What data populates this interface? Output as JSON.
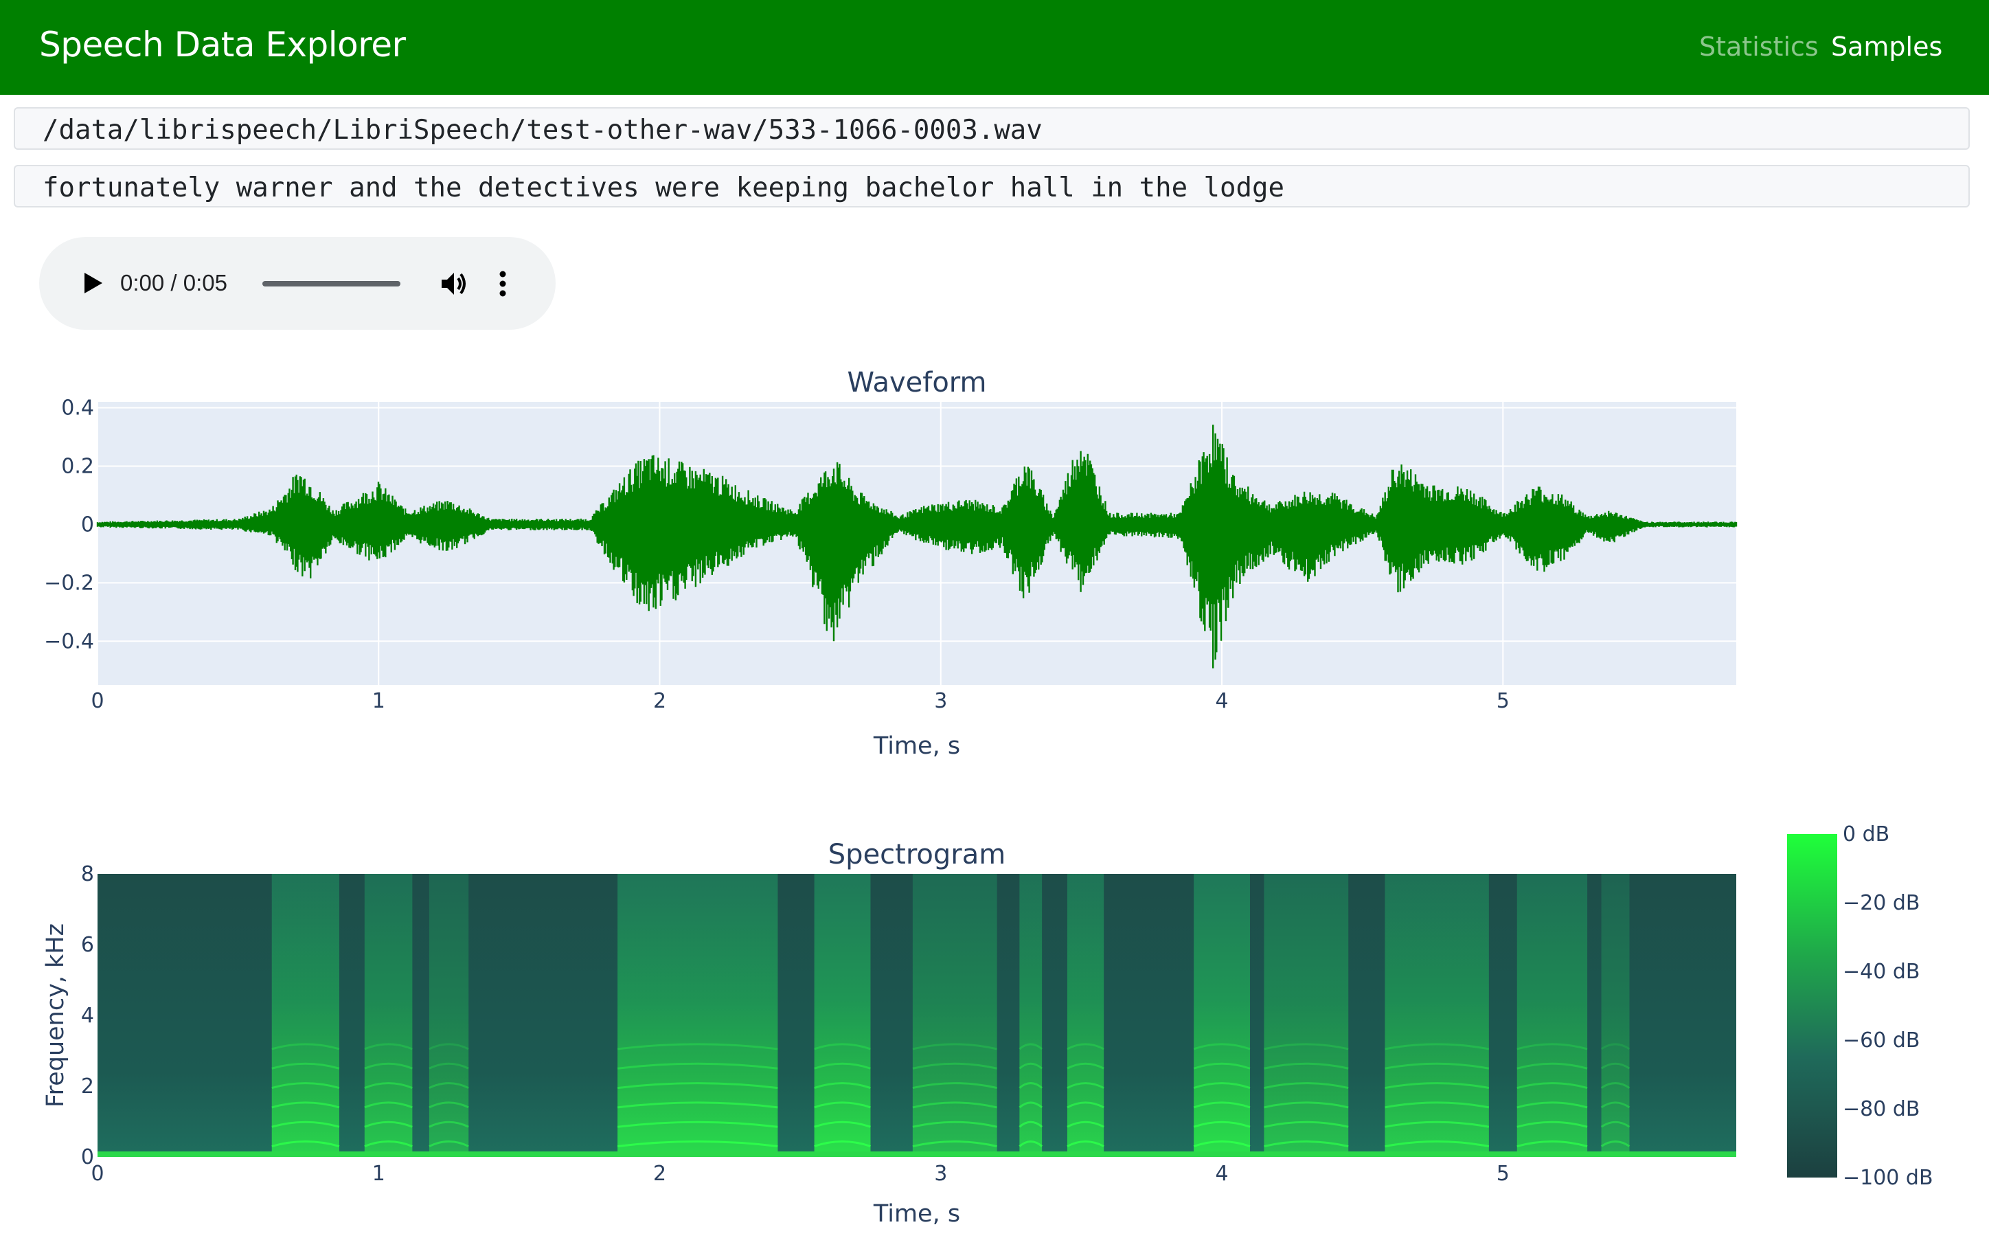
{
  "app": {
    "brand": "Speech Data Explorer",
    "nav": [
      "Statistics",
      "Samples"
    ],
    "active_nav": "Samples"
  },
  "sample": {
    "audio_path": "/data/librispeech/LibriSpeech/test-other-wav/533-1066-0003.wav",
    "transcript": "fortunately warner and the detectives were keeping bachelor hall in the lodge"
  },
  "player": {
    "time": "0:00 / 0:05",
    "progress": 0
  },
  "colors": {
    "navbar": "#008000",
    "waveform": "#008000",
    "plot_bg": "#e5ecf6",
    "colorscale_low": "#1c4040",
    "colorscale_high": "#1fff3a"
  },
  "chart_data": [
    {
      "type": "line",
      "title": "Waveform",
      "xlabel": "Time, s",
      "ylabel": "",
      "xlim": [
        0,
        5.83
      ],
      "ylim": [
        -0.55,
        0.42
      ],
      "x_ticks": [
        "0",
        "1",
        "2",
        "3",
        "4",
        "5"
      ],
      "y_ticks": [
        "0.4",
        "0.2",
        "0",
        "−0.2",
        "−0.4"
      ],
      "grid": true,
      "series": [
        {
          "color": "#008000",
          "envelope": [
            {
              "t": 0.0,
              "top": 0.01,
              "bottom": -0.01
            },
            {
              "t": 0.5,
              "top": 0.02,
              "bottom": -0.02
            },
            {
              "t": 0.62,
              "top": 0.06,
              "bottom": -0.04
            },
            {
              "t": 0.72,
              "top": 0.2,
              "bottom": -0.18
            },
            {
              "t": 0.76,
              "top": 0.16,
              "bottom": -0.19
            },
            {
              "t": 0.84,
              "top": 0.05,
              "bottom": -0.06
            },
            {
              "t": 1.0,
              "top": 0.15,
              "bottom": -0.14
            },
            {
              "t": 1.1,
              "top": 0.05,
              "bottom": -0.05
            },
            {
              "t": 1.25,
              "top": 0.09,
              "bottom": -0.1
            },
            {
              "t": 1.4,
              "top": 0.02,
              "bottom": -0.02
            },
            {
              "t": 1.75,
              "top": 0.02,
              "bottom": -0.02
            },
            {
              "t": 1.9,
              "top": 0.2,
              "bottom": -0.26
            },
            {
              "t": 1.96,
              "top": 0.25,
              "bottom": -0.33
            },
            {
              "t": 2.1,
              "top": 0.21,
              "bottom": -0.24
            },
            {
              "t": 2.2,
              "top": 0.18,
              "bottom": -0.17
            },
            {
              "t": 2.35,
              "top": 0.1,
              "bottom": -0.08
            },
            {
              "t": 2.48,
              "top": 0.05,
              "bottom": -0.04
            },
            {
              "t": 2.62,
              "top": 0.24,
              "bottom": -0.44
            },
            {
              "t": 2.7,
              "top": 0.12,
              "bottom": -0.22
            },
            {
              "t": 2.85,
              "top": 0.03,
              "bottom": -0.03
            },
            {
              "t": 2.95,
              "top": 0.07,
              "bottom": -0.07
            },
            {
              "t": 3.1,
              "top": 0.09,
              "bottom": -0.11
            },
            {
              "t": 3.22,
              "top": 0.06,
              "bottom": -0.08
            },
            {
              "t": 3.3,
              "top": 0.24,
              "bottom": -0.28
            },
            {
              "t": 3.4,
              "top": 0.03,
              "bottom": -0.04
            },
            {
              "t": 3.5,
              "top": 0.33,
              "bottom": -0.24
            },
            {
              "t": 3.6,
              "top": 0.04,
              "bottom": -0.04
            },
            {
              "t": 3.85,
              "top": 0.04,
              "bottom": -0.05
            },
            {
              "t": 3.97,
              "top": 0.36,
              "bottom": -0.5
            },
            {
              "t": 4.05,
              "top": 0.16,
              "bottom": -0.22
            },
            {
              "t": 4.18,
              "top": 0.07,
              "bottom": -0.1
            },
            {
              "t": 4.3,
              "top": 0.12,
              "bottom": -0.21
            },
            {
              "t": 4.4,
              "top": 0.11,
              "bottom": -0.11
            },
            {
              "t": 4.55,
              "top": 0.03,
              "bottom": -0.03
            },
            {
              "t": 4.62,
              "top": 0.23,
              "bottom": -0.25
            },
            {
              "t": 4.75,
              "top": 0.14,
              "bottom": -0.13
            },
            {
              "t": 4.88,
              "top": 0.13,
              "bottom": -0.14
            },
            {
              "t": 5.0,
              "top": 0.04,
              "bottom": -0.04
            },
            {
              "t": 5.12,
              "top": 0.14,
              "bottom": -0.17
            },
            {
              "t": 5.22,
              "top": 0.1,
              "bottom": -0.14
            },
            {
              "t": 5.3,
              "top": 0.03,
              "bottom": -0.03
            },
            {
              "t": 5.38,
              "top": 0.05,
              "bottom": -0.07
            },
            {
              "t": 5.5,
              "top": 0.01,
              "bottom": -0.01
            },
            {
              "t": 5.83,
              "top": 0.01,
              "bottom": -0.01
            }
          ]
        }
      ]
    },
    {
      "type": "heatmap",
      "title": "Spectrogram",
      "xlabel": "Time, s",
      "ylabel": "Frequency, kHz",
      "xlim": [
        0,
        5.83
      ],
      "ylim": [
        0,
        8
      ],
      "x_ticks": [
        "0",
        "1",
        "2",
        "3",
        "4",
        "5"
      ],
      "y_ticks": [
        "8",
        "6",
        "4",
        "2",
        "0"
      ],
      "colorbar": {
        "ticks": [
          "0 dB",
          "−20 dB",
          "−40 dB",
          "−60 dB",
          "−80 dB",
          "−100 dB"
        ],
        "range": [
          -100,
          0
        ]
      },
      "voiced_segments": [
        {
          "start": 0.62,
          "end": 0.86,
          "level": 0.85
        },
        {
          "start": 0.95,
          "end": 1.12,
          "level": 0.75
        },
        {
          "start": 1.18,
          "end": 1.32,
          "level": 0.55
        },
        {
          "start": 1.85,
          "end": 2.42,
          "level": 0.9
        },
        {
          "start": 2.55,
          "end": 2.75,
          "level": 0.95
        },
        {
          "start": 2.9,
          "end": 3.2,
          "level": 0.65
        },
        {
          "start": 3.28,
          "end": 3.36,
          "level": 0.8
        },
        {
          "start": 3.45,
          "end": 3.58,
          "level": 0.85
        },
        {
          "start": 3.9,
          "end": 4.1,
          "level": 0.95
        },
        {
          "start": 4.15,
          "end": 4.45,
          "level": 0.7
        },
        {
          "start": 4.58,
          "end": 4.95,
          "level": 0.8
        },
        {
          "start": 5.05,
          "end": 5.3,
          "level": 0.75
        },
        {
          "start": 5.35,
          "end": 5.45,
          "level": 0.5
        }
      ]
    }
  ]
}
